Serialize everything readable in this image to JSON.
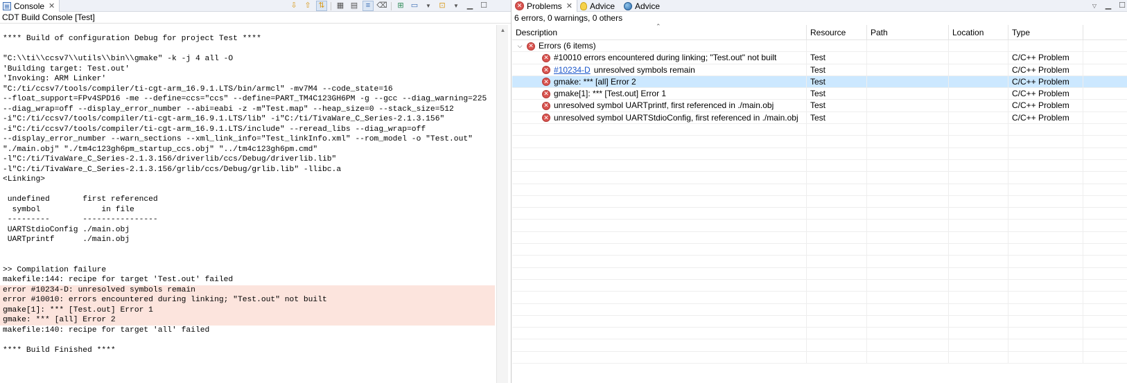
{
  "console": {
    "tab_title": "Console",
    "close_glyph": "✕",
    "subtitle": "CDT Build Console [Test]",
    "toolbar_icons": [
      "scroll-lock-down-icon",
      "previous-error-icon",
      "next-error-icon",
      "copy-build-log-icon",
      "open-build-log-icon",
      "pin-console-icon",
      "clear-console-icon",
      "new-console-icon",
      "display-selected-console-icon",
      "open-console-icon",
      "minimize-icon",
      "maximize-icon"
    ],
    "lines": [
      {
        "text": "**** Build of configuration Debug for project Test ****",
        "error": false
      },
      {
        "text": "",
        "error": false
      },
      {
        "text": "\"C:\\\\ti\\\\ccsv7\\\\utils\\\\bin\\\\gmake\" -k -j 4 all -O",
        "error": false
      },
      {
        "text": "'Building target: Test.out'",
        "error": false
      },
      {
        "text": "'Invoking: ARM Linker'",
        "error": false
      },
      {
        "text": "\"C:/ti/ccsv7/tools/compiler/ti-cgt-arm_16.9.1.LTS/bin/armcl\" -mv7M4 --code_state=16",
        "error": false
      },
      {
        "text": "--float_support=FPv4SPD16 -me --define=ccs=\"ccs\" --define=PART_TM4C123GH6PM -g --gcc --diag_warning=225",
        "error": false
      },
      {
        "text": "--diag_wrap=off --display_error_number --abi=eabi -z -m\"Test.map\" --heap_size=0 --stack_size=512",
        "error": false
      },
      {
        "text": "-i\"C:/ti/ccsv7/tools/compiler/ti-cgt-arm_16.9.1.LTS/lib\" -i\"C:/ti/TivaWare_C_Series-2.1.3.156\"",
        "error": false
      },
      {
        "text": "-i\"C:/ti/ccsv7/tools/compiler/ti-cgt-arm_16.9.1.LTS/include\" --reread_libs --diag_wrap=off",
        "error": false
      },
      {
        "text": "--display_error_number --warn_sections --xml_link_info=\"Test_linkInfo.xml\" --rom_model -o \"Test.out\"",
        "error": false
      },
      {
        "text": "\"./main.obj\" \"./tm4c123gh6pm_startup_ccs.obj\" \"../tm4c123gh6pm.cmd\"",
        "error": false
      },
      {
        "text": "-l\"C:/ti/TivaWare_C_Series-2.1.3.156/driverlib/ccs/Debug/driverlib.lib\"",
        "error": false
      },
      {
        "text": "-l\"C:/ti/TivaWare_C_Series-2.1.3.156/grlib/ccs/Debug/grlib.lib\" -llibc.a",
        "error": false
      },
      {
        "text": "<Linking>",
        "error": false
      },
      {
        "text": "",
        "error": false
      },
      {
        "text": " undefined       first referenced",
        "error": false
      },
      {
        "text": "  symbol             in file",
        "error": false
      },
      {
        "text": " ---------       ----------------",
        "error": false
      },
      {
        "text": " UARTStdioConfig ./main.obj",
        "error": false
      },
      {
        "text": " UARTprintf      ./main.obj",
        "error": false
      },
      {
        "text": "",
        "error": false
      },
      {
        "text": "",
        "error": false
      },
      {
        "text": ">> Compilation failure",
        "error": false
      },
      {
        "text": "makefile:144: recipe for target 'Test.out' failed",
        "error": false
      },
      {
        "text": "error #10234-D: unresolved symbols remain",
        "error": true
      },
      {
        "text": "error #10010: errors encountered during linking; \"Test.out\" not built",
        "error": true
      },
      {
        "text": "gmake[1]: *** [Test.out] Error 1",
        "error": true
      },
      {
        "text": "gmake: *** [all] Error 2",
        "error": true
      },
      {
        "text": "makefile:140: recipe for target 'all' failed",
        "error": false
      },
      {
        "text": "",
        "error": false
      },
      {
        "text": "**** Build Finished ****",
        "error": false
      }
    ]
  },
  "problems": {
    "tabs": [
      {
        "label": "Problems",
        "icon": "problems-icon",
        "active": true
      },
      {
        "label": "Advice",
        "icon": "lightbulb-icon",
        "active": false
      },
      {
        "label": "Advice",
        "icon": "globe-icon",
        "active": false
      }
    ],
    "close_glyph": "✕",
    "summary": "6 errors, 0 warnings, 0 others",
    "columns": [
      "Description",
      "Resource",
      "Path",
      "Location",
      "Type"
    ],
    "group": {
      "label": "Errors (6 items)",
      "expanded": true
    },
    "rows": [
      {
        "link": "",
        "description": "#10010 errors encountered during linking; \"Test.out\" not built",
        "resource": "Test",
        "path": "",
        "location": "",
        "type": "C/C++ Problem",
        "selected": false
      },
      {
        "link": "#10234-D",
        "description": "unresolved symbols remain",
        "resource": "Test",
        "path": "",
        "location": "",
        "type": "C/C++ Problem",
        "selected": false
      },
      {
        "link": "",
        "description": "gmake: *** [all] Error 2",
        "resource": "Test",
        "path": "",
        "location": "",
        "type": "C/C++ Problem",
        "selected": true
      },
      {
        "link": "",
        "description": "gmake[1]: *** [Test.out] Error 1",
        "resource": "Test",
        "path": "",
        "location": "",
        "type": "C/C++ Problem",
        "selected": false
      },
      {
        "link": "",
        "description": "unresolved symbol UARTprintf, first referenced in ./main.obj",
        "resource": "Test",
        "path": "",
        "location": "",
        "type": "C/C++ Problem",
        "selected": false
      },
      {
        "link": "",
        "description": "unresolved symbol UARTStdioConfig, first referenced in ./main.obj",
        "resource": "Test",
        "path": "",
        "location": "",
        "type": "C/C++ Problem",
        "selected": false
      }
    ]
  }
}
